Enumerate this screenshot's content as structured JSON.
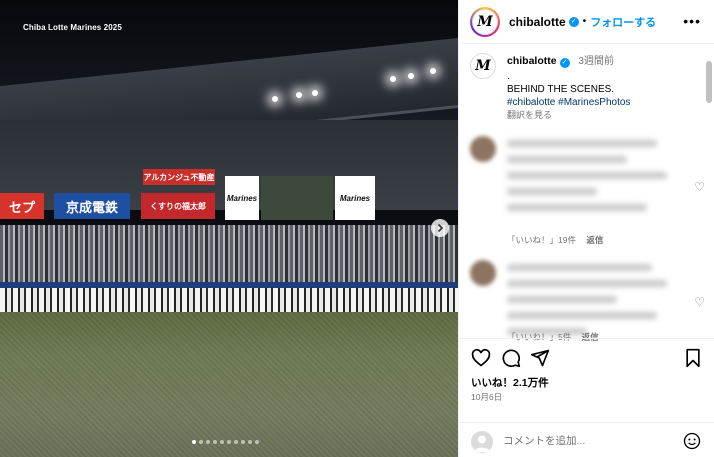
{
  "photo": {
    "watermark": "Chiba Lotte Marines 2025",
    "signs": {
      "arakanju": "アルカンジュ不動産",
      "setsupu": "セプ",
      "keisei": "京成電鉄",
      "kusuri": "くすりの福太郎",
      "screen_logo": "Marines"
    },
    "carousel": {
      "count": 10,
      "active_index": 0
    }
  },
  "header": {
    "username": "chibalotte",
    "separator": "•",
    "follow_label": "フォローする",
    "more_label": "•••"
  },
  "caption": {
    "username": "chibalotte",
    "time": "3週間前",
    "line1": ".",
    "line2": "BEHIND THE SCENES.",
    "hashtags": "#chibalotte #MarinesPhotos",
    "translate": "翻訳を見る"
  },
  "comments": [
    {
      "likes_label": "「いいね！」19件",
      "reply_label": "返信"
    },
    {
      "likes_label": "「いいね！」5件",
      "reply_label": "返信"
    }
  ],
  "actions": {
    "likes": "いいね！2.1万件",
    "date": "10月6日"
  },
  "add_comment": {
    "placeholder": "コメントを追加..."
  }
}
